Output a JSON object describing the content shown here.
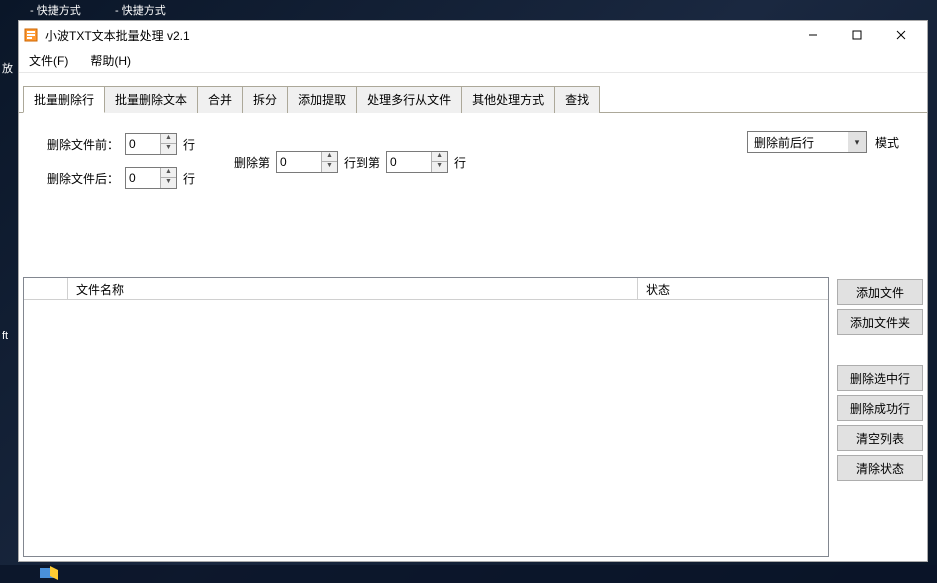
{
  "desktop": {
    "shortcut1": "- 快捷方式",
    "shortcut2": "- 快捷方式",
    "side_label1": "放",
    "side_label2": "ft"
  },
  "window": {
    "title": "小波TXT文本批量处理 v2.1"
  },
  "menu": {
    "file": "文件(F)",
    "help": "帮助(H)"
  },
  "tabs": {
    "t0": "批量删除行",
    "t1": "批量删除文本",
    "t2": "合并",
    "t3": "拆分",
    "t4": "添加提取",
    "t5": "处理多行从文件",
    "t6": "其他处理方式",
    "t7": "查找"
  },
  "form": {
    "del_before_label": "删除文件前：",
    "del_before_value": "0",
    "del_after_label": "删除文件后：",
    "del_after_value": "0",
    "line_suffix": "行",
    "del_nth_label": "删除第",
    "del_nth_value": "0",
    "to_nth_label": "行到第",
    "to_nth_value": "0",
    "mode_value": "删除前后行",
    "mode_label": "模式"
  },
  "table": {
    "col_name": "文件名称",
    "col_status": "状态"
  },
  "buttons": {
    "add_file": "添加文件",
    "add_folder": "添加文件夹",
    "del_selected": "删除选中行",
    "del_success": "删除成功行",
    "clear_list": "清空列表",
    "clear_status": "清除状态"
  }
}
